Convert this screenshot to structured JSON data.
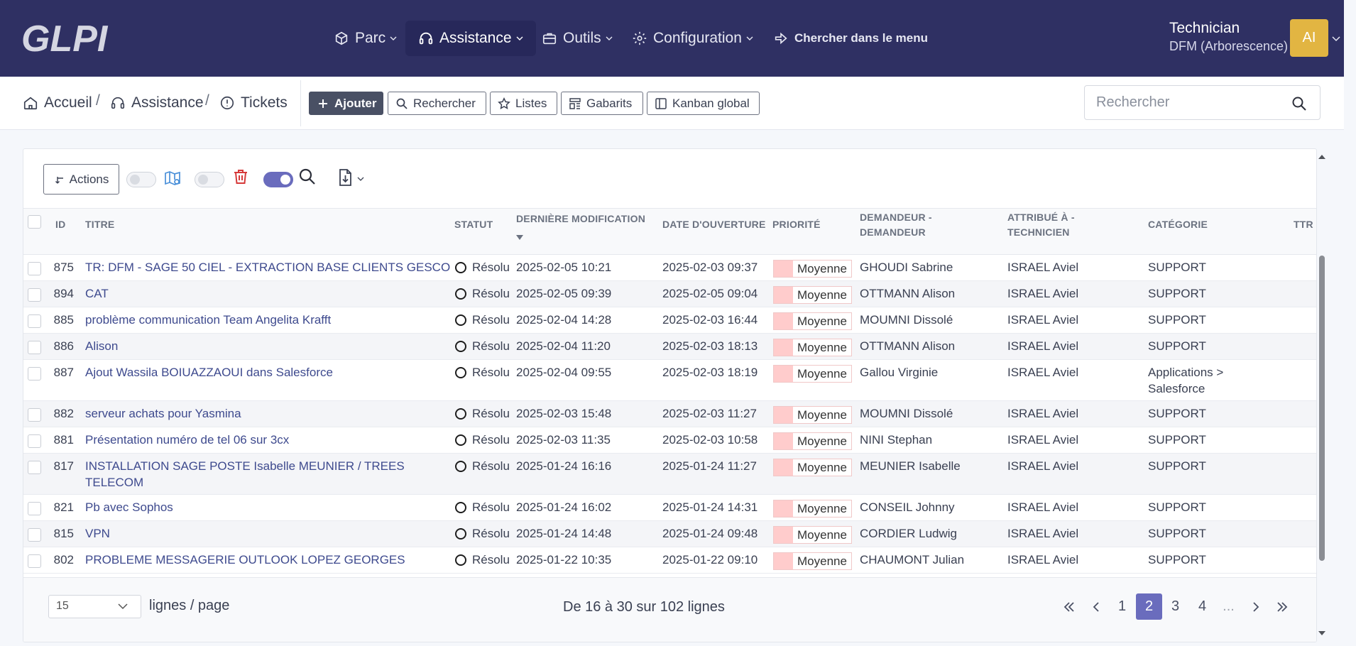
{
  "brand": {
    "logo_text": "GLPI"
  },
  "nav": [
    {
      "label": "Parc",
      "icon": "box-icon"
    },
    {
      "label": "Assistance",
      "icon": "headset-icon"
    },
    {
      "label": "Outils",
      "icon": "briefcase-icon"
    },
    {
      "label": "Configuration",
      "icon": "gear-icon"
    },
    {
      "label": "Chercher dans le menu",
      "icon": "arrow-right-icon"
    }
  ],
  "user": {
    "profile": "Technician",
    "entity": "DFM (Arborescence)",
    "initials": "AI"
  },
  "breadcrumb": [
    {
      "label": "Accueil",
      "icon": "home-icon"
    },
    {
      "label": "Assistance",
      "icon": "headset-icon"
    },
    {
      "label": "Tickets",
      "icon": "alert-circle-icon"
    }
  ],
  "toolbar": {
    "add": "Ajouter",
    "search": "Rechercher",
    "lists": "Listes",
    "templates": "Gabarits",
    "kanban": "Kanban global"
  },
  "global_search": {
    "placeholder": "Rechercher"
  },
  "list_controls": {
    "actions": "Actions"
  },
  "columns": {
    "id": "ID",
    "title": "TITRE",
    "status": "STATUT",
    "modified_line1": "DERNIÈRE MODIFICATION",
    "opened": "DATE D'OUVERTURE",
    "priority": "PRIORITÉ",
    "requester_line1": "DEMANDEUR -",
    "requester_line2": "DEMANDEUR",
    "assigned_line1": "ATTRIBUÉ À -",
    "assigned_line2": "TECHNICIEN",
    "category": "CATÉGORIE",
    "ttr": "TTR"
  },
  "tickets": [
    {
      "id": "875",
      "title": [
        "TR: DFM - SAGE 50 CIEL - EXTRACTION BASE CLIENTS GESCO"
      ],
      "status": "Résolu",
      "modified": "2025-02-05 10:21",
      "opened": "2025-02-03 09:37",
      "priority": "Moyenne",
      "requester": "GHOUDI Sabrine",
      "assigned": "ISRAEL Aviel",
      "category": [
        "SUPPORT"
      ]
    },
    {
      "id": "894",
      "title": [
        "CAT"
      ],
      "status": "Résolu",
      "modified": "2025-02-05 09:39",
      "opened": "2025-02-05 09:04",
      "priority": "Moyenne",
      "requester": "OTTMANN Alison",
      "assigned": "ISRAEL Aviel",
      "category": [
        "SUPPORT"
      ]
    },
    {
      "id": "885",
      "title": [
        "problème communication Team Angelita Krafft"
      ],
      "status": "Résolu",
      "modified": "2025-02-04 14:28",
      "opened": "2025-02-03 16:44",
      "priority": "Moyenne",
      "requester": "MOUMNI Dissolé",
      "assigned": "ISRAEL Aviel",
      "category": [
        "SUPPORT"
      ]
    },
    {
      "id": "886",
      "title": [
        "Alison"
      ],
      "status": "Résolu",
      "modified": "2025-02-04 11:20",
      "opened": "2025-02-03 18:13",
      "priority": "Moyenne",
      "requester": "OTTMANN Alison",
      "assigned": "ISRAEL Aviel",
      "category": [
        "SUPPORT"
      ]
    },
    {
      "id": "887",
      "title": [
        "Ajout Wassila BOIUAZZAOUI dans Salesforce"
      ],
      "status": "Résolu",
      "modified": "2025-02-04 09:55",
      "opened": "2025-02-03 18:19",
      "priority": "Moyenne",
      "requester": "Gallou Virginie",
      "assigned": "ISRAEL Aviel",
      "category": [
        "Applications >",
        "Salesforce"
      ]
    },
    {
      "id": "882",
      "title": [
        "serveur achats pour Yasmina"
      ],
      "status": "Résolu",
      "modified": "2025-02-03 15:48",
      "opened": "2025-02-03 11:27",
      "priority": "Moyenne",
      "requester": "MOUMNI Dissolé",
      "assigned": "ISRAEL Aviel",
      "category": [
        "SUPPORT"
      ]
    },
    {
      "id": "881",
      "title": [
        "Présentation numéro de tel 06 sur 3cx"
      ],
      "status": "Résolu",
      "modified": "2025-02-03 11:35",
      "opened": "2025-02-03 10:58",
      "priority": "Moyenne",
      "requester": "NINI Stephan",
      "assigned": "ISRAEL Aviel",
      "category": [
        "SUPPORT"
      ]
    },
    {
      "id": "817",
      "title": [
        "INSTALLATION SAGE POSTE Isabelle MEUNIER / TREES",
        "TELECOM"
      ],
      "status": "Résolu",
      "modified": "2025-01-24 16:16",
      "opened": "2025-01-24 11:27",
      "priority": "Moyenne",
      "requester": "MEUNIER Isabelle",
      "assigned": "ISRAEL Aviel",
      "category": [
        "SUPPORT"
      ]
    },
    {
      "id": "821",
      "title": [
        "Pb avec Sophos"
      ],
      "status": "Résolu",
      "modified": "2025-01-24 16:02",
      "opened": "2025-01-24 14:31",
      "priority": "Moyenne",
      "requester": "CONSEIL Johnny",
      "assigned": "ISRAEL Aviel",
      "category": [
        "SUPPORT"
      ]
    },
    {
      "id": "815",
      "title": [
        "VPN"
      ],
      "status": "Résolu",
      "modified": "2025-01-24 14:48",
      "opened": "2025-01-24 09:48",
      "priority": "Moyenne",
      "requester": "CORDIER Ludwig",
      "assigned": "ISRAEL Aviel",
      "category": [
        "SUPPORT"
      ]
    },
    {
      "id": "802",
      "title": [
        "PROBLEME MESSAGERIE OUTLOOK LOPEZ GEORGES"
      ],
      "status": "Résolu",
      "modified": "2025-01-22 10:35",
      "opened": "2025-01-22 09:10",
      "priority": "Moyenne",
      "requester": "CHAUMONT Julian",
      "assigned": "ISRAEL Aviel",
      "category": [
        "SUPPORT"
      ]
    }
  ],
  "pagination": {
    "per_page": "15",
    "per_page_label": "lignes / page",
    "range": "De 16 à 30 sur 102 lignes",
    "pages": [
      "1",
      "2",
      "3",
      "4"
    ],
    "current_page": "2",
    "ellipsis": "..."
  },
  "colors": {
    "topbar": "#2f3063",
    "accent": "#6a6cbd",
    "avatar": "#e2b542",
    "priority_medium": "#ffcccc",
    "title_link": "#3e4a8e"
  }
}
